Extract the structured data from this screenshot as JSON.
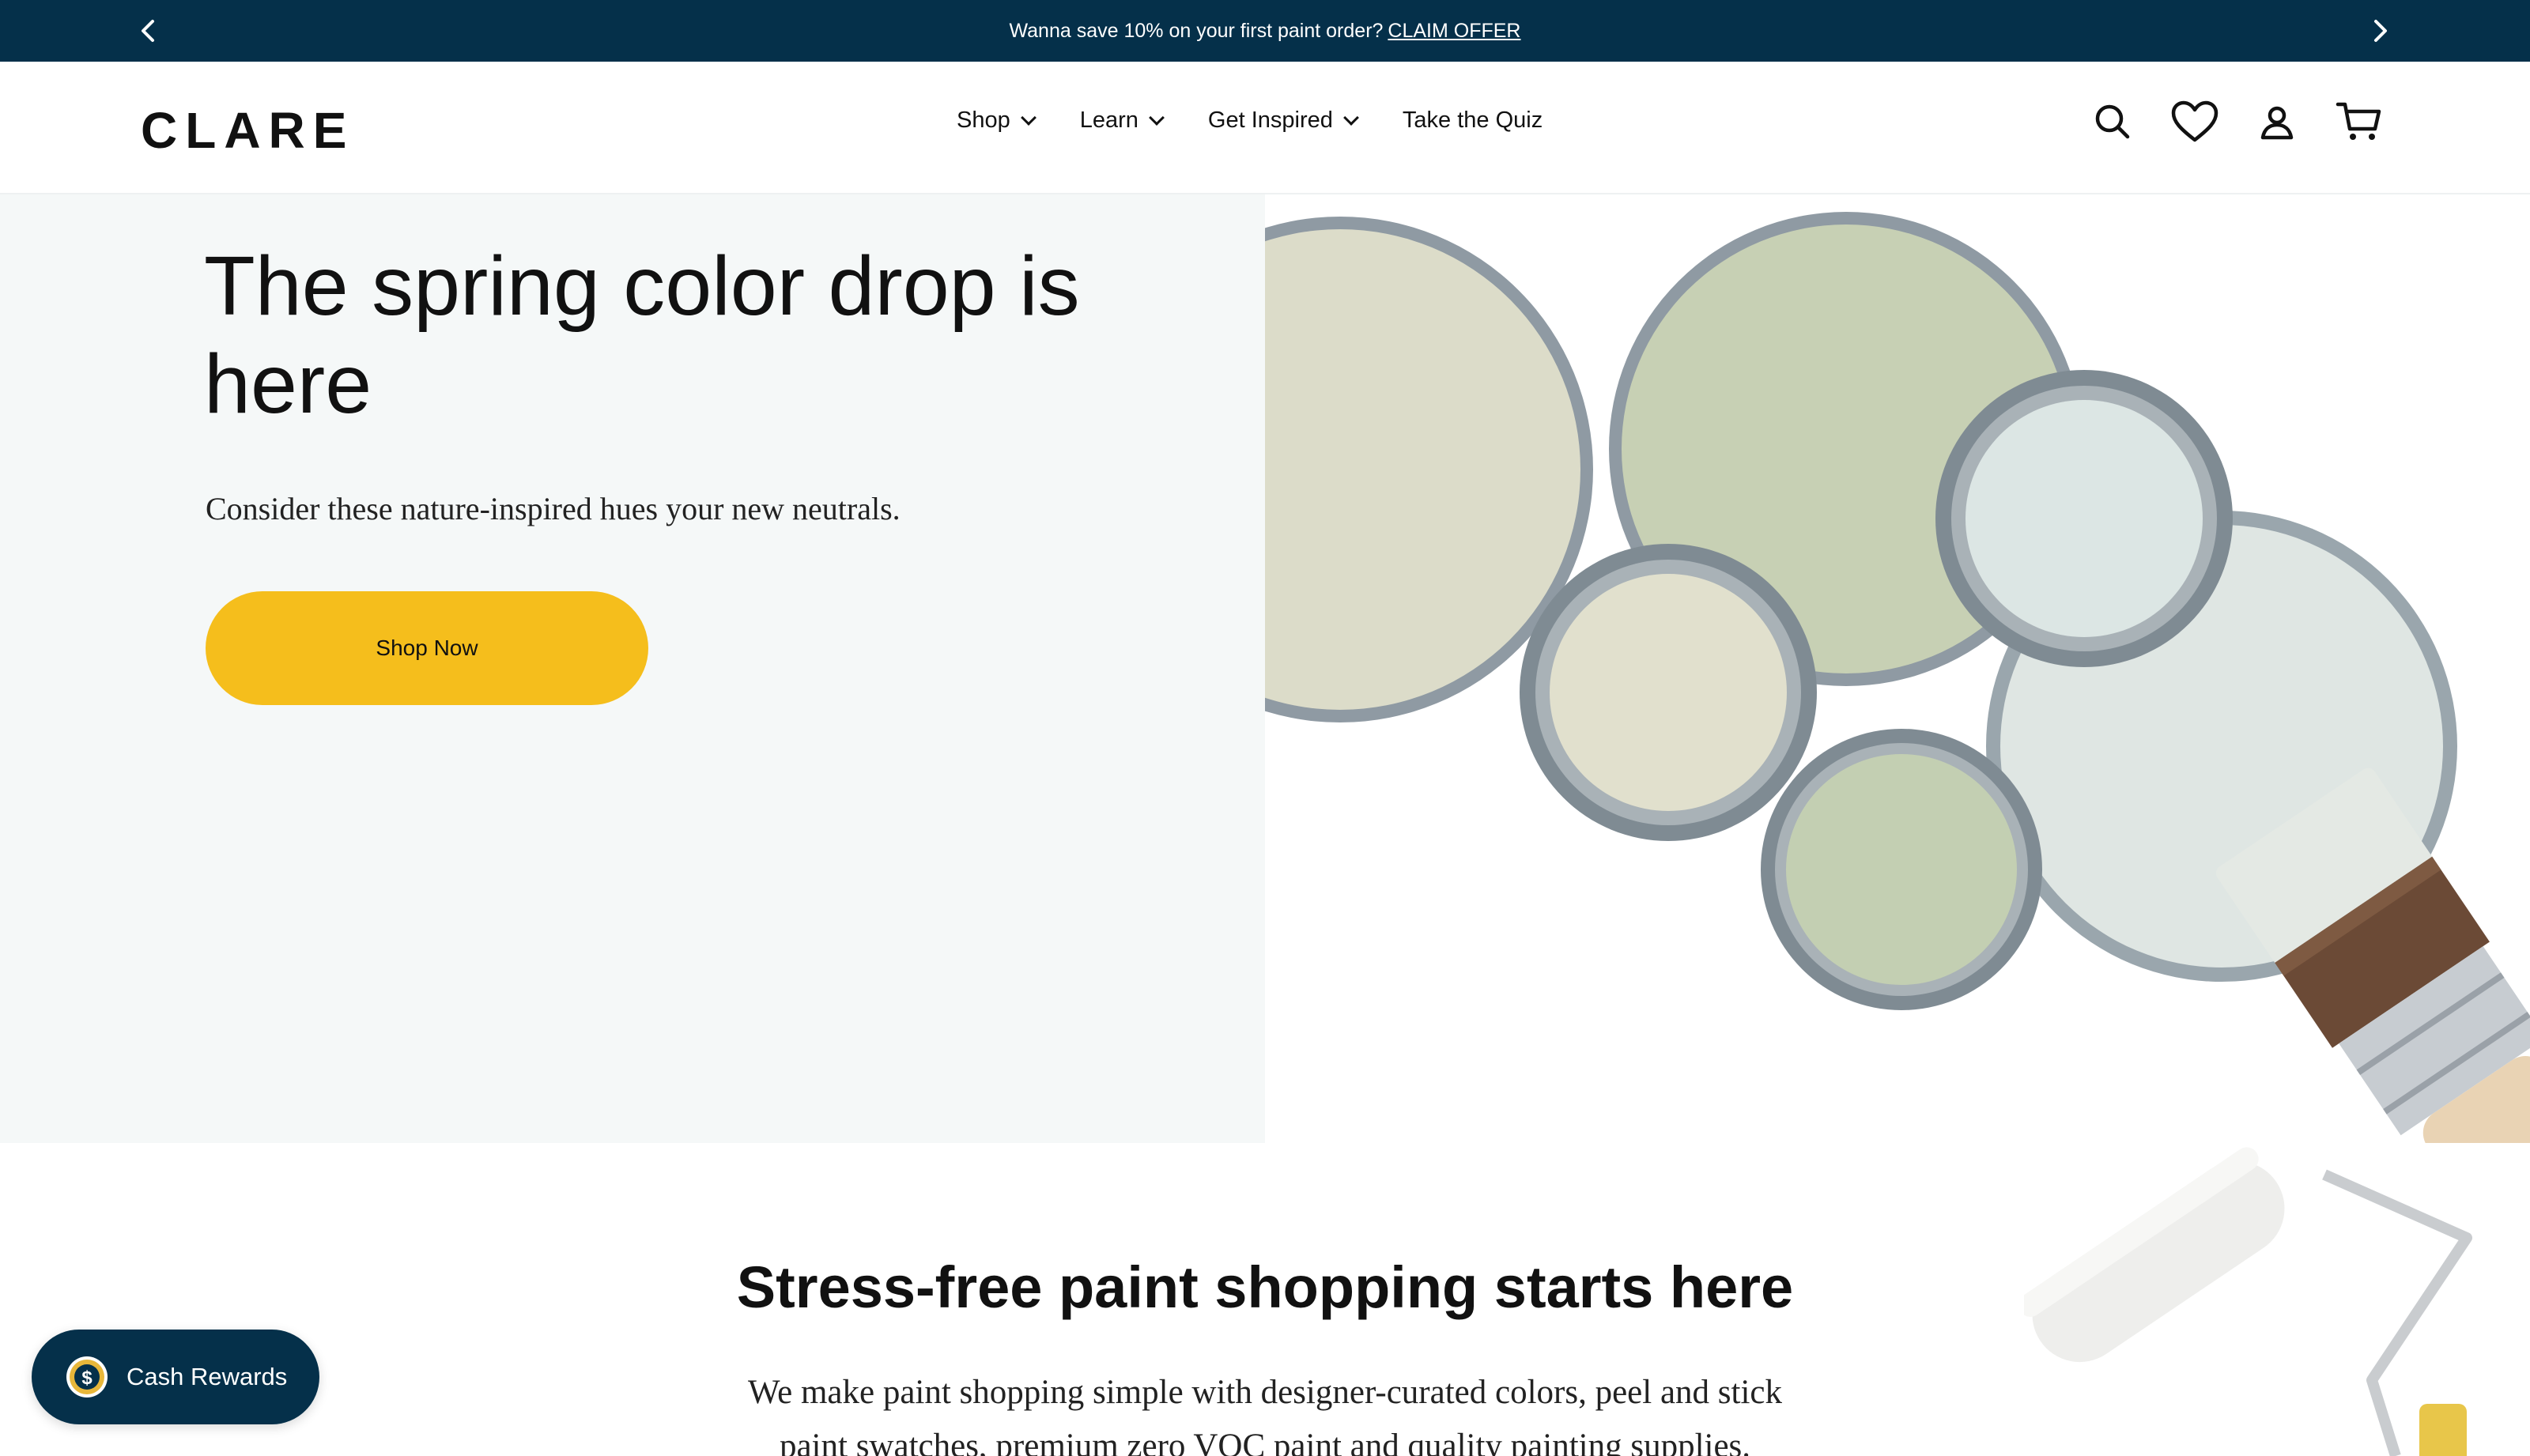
{
  "announcement": {
    "text": "Wanna save 10% on your first paint order?",
    "cta": "CLAIM OFFER",
    "prev_icon": "chevron-left-icon",
    "next_icon": "chevron-right-icon"
  },
  "header": {
    "logo": "CLARE",
    "nav": [
      {
        "label": "Shop",
        "has_dropdown": true
      },
      {
        "label": "Learn",
        "has_dropdown": true
      },
      {
        "label": "Get Inspired",
        "has_dropdown": true
      },
      {
        "label": "Take the Quiz",
        "has_dropdown": false
      }
    ],
    "icons": [
      "search-icon",
      "heart-icon",
      "account-icon",
      "cart-icon"
    ]
  },
  "hero": {
    "title": "The spring color drop is here",
    "subtitle": "Consider these nature-inspired hues your new neutrals.",
    "button": "Shop Now",
    "image_description_icon": "paint-cans-brush-image"
  },
  "section": {
    "title": "Stress-free paint shopping starts here",
    "text": "We make paint shopping simple with designer-curated colors, peel and stick paint swatches, premium zero VOC paint and quality painting supplies."
  },
  "rewards": {
    "label": "Cash Rewards",
    "icon": "dollar-coin-icon"
  },
  "colors": {
    "announcement_bg": "#05304a",
    "button_yellow": "#f5be1c",
    "hero_bg": "#f5f8f8",
    "rewards_bg": "#05304a"
  }
}
